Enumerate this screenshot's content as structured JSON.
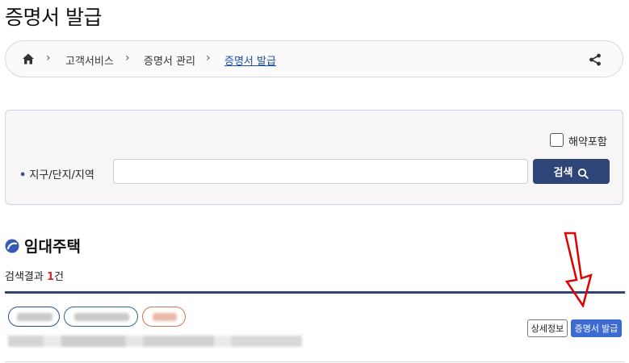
{
  "page": {
    "title": "증명서 발급"
  },
  "breadcrumb": {
    "items": [
      "고객서비스",
      "증명서 관리",
      "증명서 발급"
    ],
    "separator": ">"
  },
  "search": {
    "checkbox_label": "해약포함",
    "checkbox_checked": false,
    "field_label": "지구/단지/지역",
    "input_value": "",
    "button_label": "검색"
  },
  "results": {
    "section_title": "임대주택",
    "count_prefix": "검색결과 ",
    "count_value": "1",
    "count_suffix": "건",
    "rows": [
      {
        "detail_button": "상세정보",
        "issue_button": "증명서 발급"
      }
    ]
  },
  "colors": {
    "accent_navy": "#2f4477",
    "issue_blue": "#3c6bd1",
    "count_red": "#d42b2b",
    "annotation_arrow": "#e00000"
  }
}
